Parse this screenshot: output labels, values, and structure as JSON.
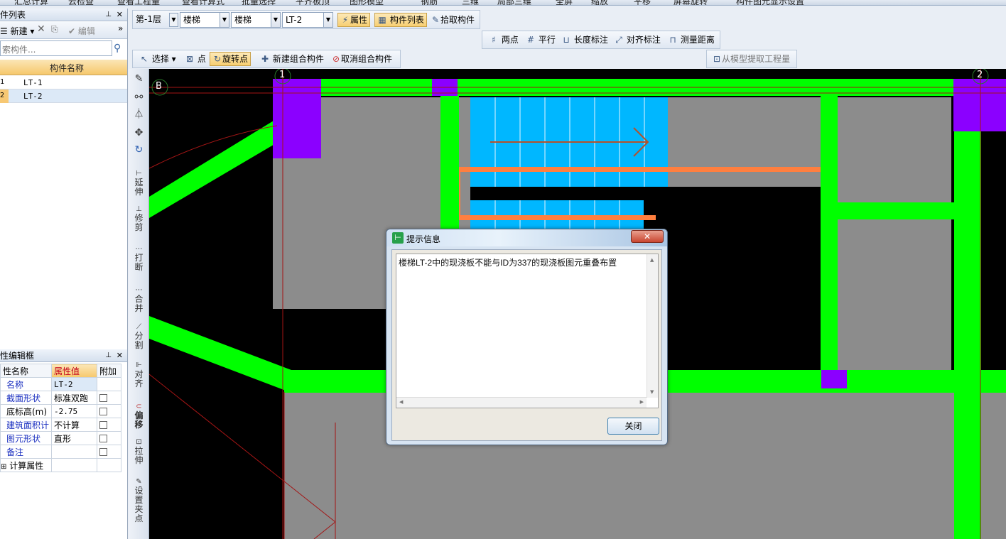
{
  "topmenu": {
    "items": [
      "汇总计算",
      "云检查",
      "查看工程量",
      "查看计算式",
      "批量选择",
      "平齐板顶",
      "图形模型",
      "钢筋",
      "三维",
      "局部三维",
      "全屏",
      "缩放",
      "平移",
      "屏幕旋转",
      "构件图元显示设置"
    ]
  },
  "component_list_panel": {
    "title": "件列表",
    "new_label": "新建",
    "edit_label": "编辑",
    "search_placeholder": "索构件...",
    "header": "构件名称",
    "rows": [
      {
        "idx": "1",
        "name": "LT-1"
      },
      {
        "idx": "2",
        "name": "LT-2"
      }
    ]
  },
  "property_panel": {
    "title": "性编辑框",
    "headers": [
      "性名称",
      "属性值",
      "附加"
    ],
    "rows": [
      {
        "name": "名称",
        "value": "LT-2"
      },
      {
        "name": "截面形状",
        "value": "标准双跑"
      },
      {
        "name": "底标高(m)",
        "value": "-2.75"
      },
      {
        "name": "建筑面积计",
        "value": "不计算"
      },
      {
        "name": "图元形状",
        "value": "直形"
      },
      {
        "name": "备注",
        "value": ""
      },
      {
        "name": "计算属性",
        "value": ""
      }
    ]
  },
  "toolbar1": {
    "floor": "第-1层",
    "type1": "楼梯",
    "type2": "楼梯",
    "component": "LT-2",
    "props": "属性",
    "complist": "构件列表",
    "pick": "拾取构件"
  },
  "toolbar2": {
    "two_points": "两点",
    "parallel": "平行",
    "length_dim": "长度标注",
    "aligned_dim": "对齐标注",
    "measure": "测量距离"
  },
  "toolbar3": {
    "select": "选择",
    "point": "点",
    "rotate_point": "旋转点",
    "new_combo": "新建组合构件",
    "cancel_combo": "取消组合构件",
    "extract": "从模型提取工程量"
  },
  "vtools": [
    "延伸",
    "修剪",
    "打断",
    "合并",
    "分割",
    "对齐",
    "偏移",
    "拉伸",
    "设置夹点"
  ],
  "axis": {
    "left_label": "B",
    "top1": "1",
    "top2": "2"
  },
  "dialog": {
    "title": "提示信息",
    "message": "楼梯LT-2中的现浇板不能与ID为337的现浇板图元重叠布置",
    "close": "关闭"
  },
  "colors": {
    "green": "#00ff00",
    "purple": "#8b00ff",
    "gray": "#8c8c8c",
    "cyan": "#00b7ff",
    "orange": "#ff7f3f"
  }
}
